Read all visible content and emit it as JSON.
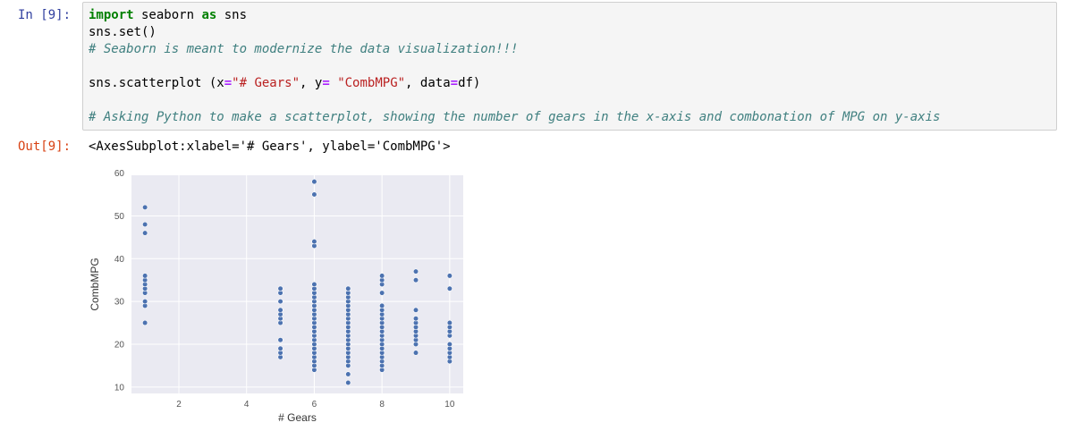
{
  "cell": {
    "in_prompt": "In [9]:",
    "out_prompt": "Out[9]:",
    "code": {
      "line1": {
        "kw1": "import",
        "rest1": " seaborn ",
        "kw2": "as",
        "rest2": " sns"
      },
      "line2": "sns.set()",
      "line3": "# Seaborn is meant to modernize the data visualization!!!",
      "line5": {
        "p1": "sns.scatterplot (x",
        "op1": "=",
        "s1": "\"# Gears\"",
        "p2": ", y",
        "op2": "=",
        "p3": " ",
        "s2": "\"CombMPG\"",
        "p4": ", data",
        "op3": "=",
        "p5": "df)"
      },
      "line7": "# Asking Python to make a scatterplot, showing the number of gears in the x-axis and combonation of MPG on y-axis"
    },
    "output_text": "<AxesSubplot:xlabel='# Gears', ylabel='CombMPG'>"
  },
  "colors": {
    "axes_bg": "#eaeaf2",
    "point": "#4c72b0",
    "grid": "#ffffff"
  },
  "chart_data": {
    "type": "scatter",
    "xlabel": "# Gears",
    "ylabel": "CombMPG",
    "xlim": [
      0.6,
      10.4
    ],
    "ylim": [
      8.5,
      59.5
    ],
    "xticks": [
      2,
      4,
      6,
      8,
      10
    ],
    "yticks": [
      10,
      20,
      30,
      40,
      50,
      60
    ],
    "grid": true,
    "series": [
      {
        "x": 1,
        "y": [
          25,
          29,
          30,
          32,
          33,
          34,
          35,
          36,
          46,
          48,
          52
        ]
      },
      {
        "x": 5,
        "y": [
          17,
          18,
          19,
          21,
          25,
          26,
          27,
          28,
          30,
          32,
          33
        ]
      },
      {
        "x": 6,
        "y": [
          14,
          15,
          16,
          17,
          18,
          19,
          20,
          21,
          22,
          23,
          24,
          25,
          26,
          27,
          28,
          29,
          30,
          31,
          32,
          33,
          34,
          43,
          44,
          55,
          58
        ]
      },
      {
        "x": 7,
        "y": [
          11,
          13,
          15,
          16,
          17,
          18,
          19,
          20,
          21,
          22,
          23,
          24,
          25,
          26,
          27,
          28,
          29,
          30,
          31,
          32,
          33
        ]
      },
      {
        "x": 8,
        "y": [
          14,
          15,
          16,
          17,
          18,
          19,
          20,
          21,
          22,
          23,
          24,
          25,
          26,
          27,
          28,
          29,
          32,
          34,
          35,
          36
        ]
      },
      {
        "x": 9,
        "y": [
          18,
          20,
          21,
          22,
          23,
          24,
          25,
          26,
          28,
          35,
          37
        ]
      },
      {
        "x": 10,
        "y": [
          16,
          17,
          18,
          19,
          20,
          22,
          23,
          24,
          25,
          33,
          36
        ]
      }
    ]
  }
}
